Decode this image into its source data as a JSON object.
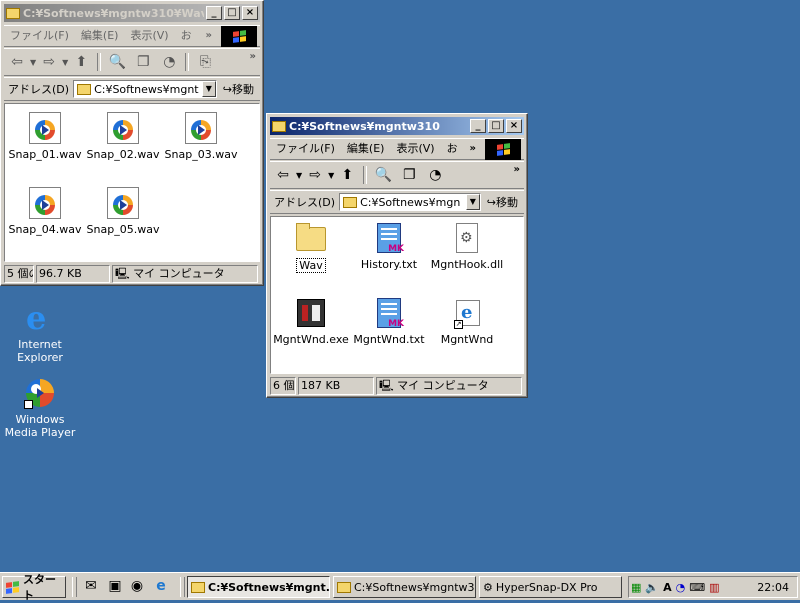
{
  "window1": {
    "title": "C:¥Softnews¥mgntw310¥Wav",
    "menu": [
      "ファイル(F)",
      "編集(E)",
      "表示(V)",
      "お"
    ],
    "address_label": "アドレス(D)",
    "address_value": "C:¥Softnews¥mgnt",
    "go_label": "移動",
    "files": [
      "Snap_01.wav",
      "Snap_02.wav",
      "Snap_03.wav",
      "Snap_04.wav",
      "Snap_05.wav"
    ],
    "status": [
      "5 個の",
      "96.7 KB",
      "マイ コンピュータ"
    ]
  },
  "window2": {
    "title": "C:¥Softnews¥mgntw310",
    "menu": [
      "ファイル(F)",
      "編集(E)",
      "表示(V)",
      "お"
    ],
    "address_label": "アドレス(D)",
    "address_value": "C:¥Softnews¥mgn",
    "go_label": "移動",
    "files": [
      "Wav",
      "History.txt",
      "MgntHook.dll",
      "MgntWnd.exe",
      "MgntWnd.txt",
      "MgntWnd"
    ],
    "status": [
      "6 個",
      "187 KB",
      "マイ コンピュータ"
    ]
  },
  "desktop": {
    "icons": [
      "Internet Explorer",
      "Windows Media Player"
    ]
  },
  "taskbar": {
    "start_label": "スタート",
    "buttons": [
      "C:¥Softnews¥mgnt...",
      "C:¥Softnews¥mgntw3...",
      "HyperSnap-DX Pro"
    ],
    "clock": "22:04"
  },
  "colors": {
    "desktop": "#3a6ea5",
    "active_title": "#0a246a",
    "inactive_title": "#808080"
  }
}
